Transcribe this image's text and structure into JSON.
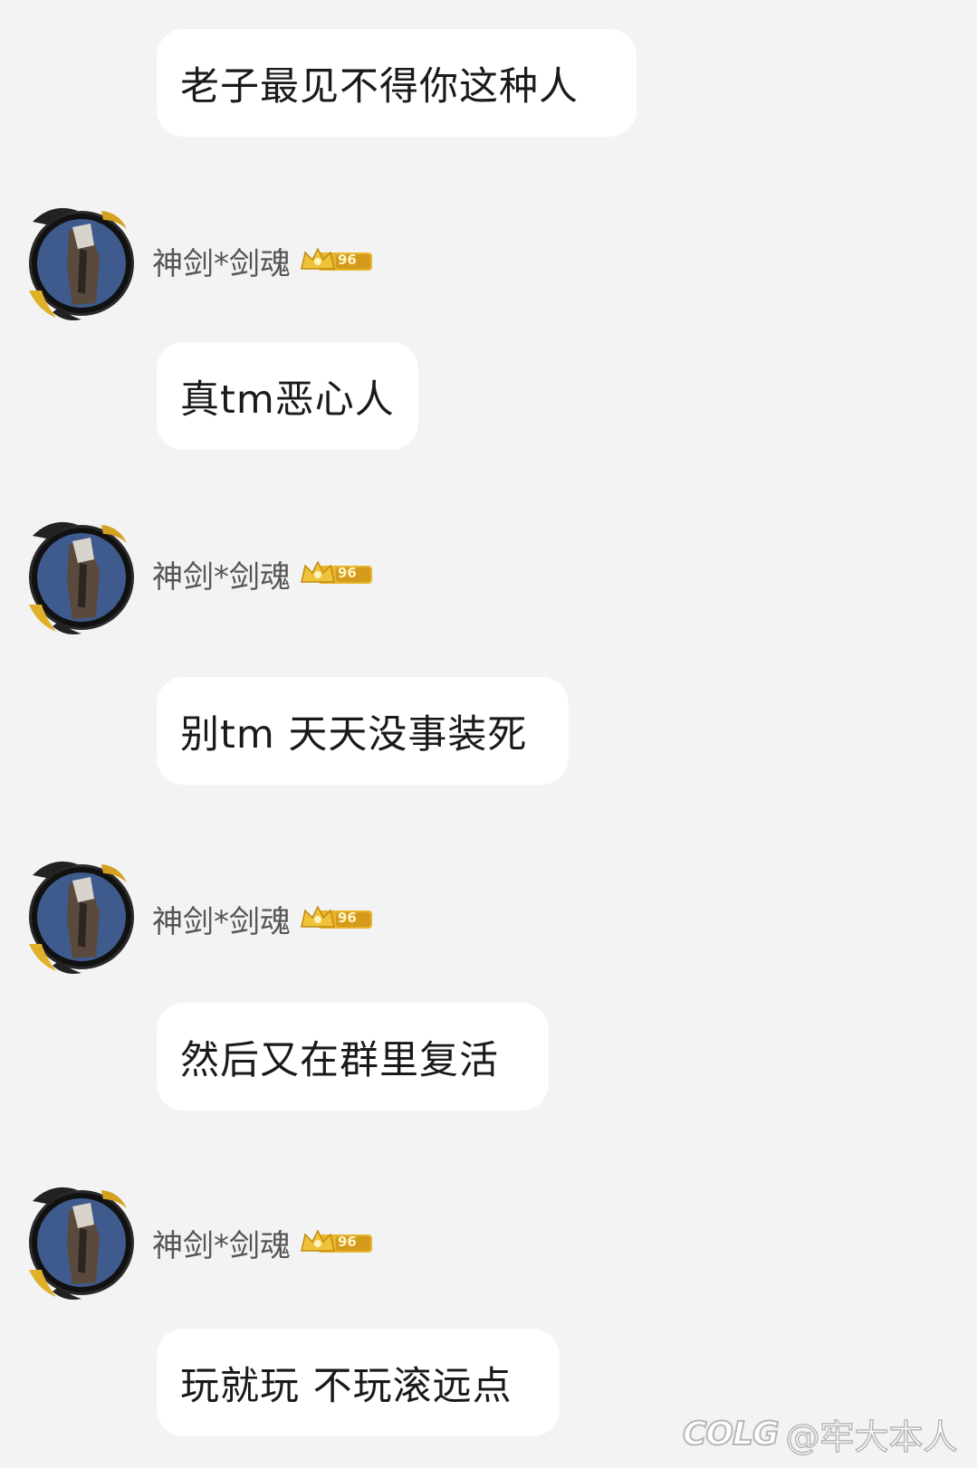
{
  "messages": [
    {
      "text": "老子最见不得你这种人"
    },
    {
      "sender": "神剑*剑魂",
      "level": "96",
      "text": "真tm恶心人"
    },
    {
      "sender": "神剑*剑魂",
      "level": "96",
      "text": "别tm 天天没事装死"
    },
    {
      "sender": "神剑*剑魂",
      "level": "96",
      "text": "然后又在群里复活"
    },
    {
      "sender": "神剑*剑魂",
      "level": "96",
      "text": "玩就玩 不玩滚远点"
    }
  ],
  "watermark": {
    "logo": "COLG",
    "handle": "@牢大本人"
  },
  "colors": {
    "background": "#f3f3f3",
    "bubble": "#ffffff",
    "badge_gold": "#e8b52a"
  },
  "icons": {
    "avatar": "warrior-avatar-icon",
    "badge": "crown-level-badge-icon"
  }
}
